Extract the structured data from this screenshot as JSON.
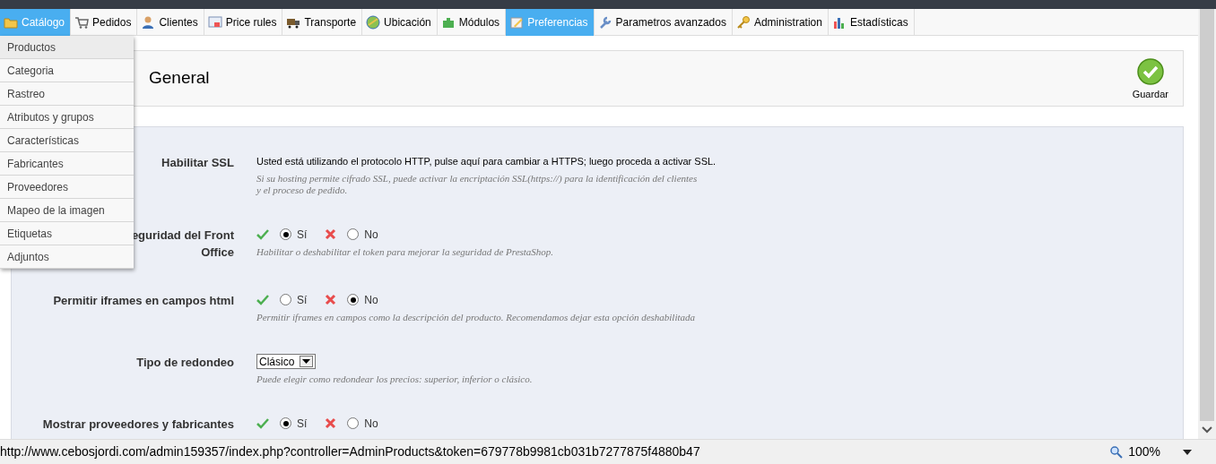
{
  "nav": [
    {
      "label": "Catálogo",
      "selected": true
    },
    {
      "label": "Pedidos",
      "selected": false
    },
    {
      "label": "Clientes",
      "selected": false
    },
    {
      "label": "Price rules",
      "selected": false
    },
    {
      "label": "Transporte",
      "selected": false
    },
    {
      "label": "Ubicación",
      "selected": false
    },
    {
      "label": "Módulos",
      "selected": false
    },
    {
      "label": "Preferencias",
      "selected": true
    },
    {
      "label": "Parametros avanzados",
      "selected": false
    },
    {
      "label": "Administration",
      "selected": false
    },
    {
      "label": "Estadísticas",
      "selected": false
    }
  ],
  "dropdown": [
    {
      "label": "Productos",
      "selected": true
    },
    {
      "label": "Categoria",
      "selected": false
    },
    {
      "label": "Rastreo",
      "selected": false
    },
    {
      "label": "Atributos y grupos",
      "selected": false
    },
    {
      "label": "Características",
      "selected": false
    },
    {
      "label": "Fabricantes",
      "selected": false
    },
    {
      "label": "Proveedores",
      "selected": false
    },
    {
      "label": "Mapeo de la imagen",
      "selected": false
    },
    {
      "label": "Etiquetas",
      "selected": false
    },
    {
      "label": "Adjuntos",
      "selected": false
    }
  ],
  "header": {
    "title": "General",
    "save_button": "Guardar"
  },
  "fields": [
    {
      "kind": "notice",
      "label": "Habilitar SSL",
      "text": "Usted está utilizando el protocolo HTTP, pulse aquí para cambiar a HTTPS; luego proceda a activar SSL.",
      "hint": "Si su hosting permite cifrado SSL, puede activar la encriptación SSL(https://) para la identificación del clientes y el proceso de pedido."
    },
    {
      "kind": "radio",
      "label": "eguridad del Front Office",
      "options": [
        {
          "label": "Sí",
          "selected": true
        },
        {
          "label": "No",
          "selected": false
        }
      ],
      "hint": "Habilitar o deshabilitar el token para mejorar la seguridad de PrestaShop."
    },
    {
      "kind": "radio",
      "label": "Permitir iframes en campos html",
      "options": [
        {
          "label": "Sí",
          "selected": false
        },
        {
          "label": "No",
          "selected": true
        }
      ],
      "hint": "Permitir iframes en campos como la descripción del producto. Recomendamos dejar esta opción deshabilitada"
    },
    {
      "kind": "select",
      "label": "Tipo de redondeo",
      "value": "Clásico",
      "hint": "Puede elegir como redondear los precios: superior, inferior o clásico."
    },
    {
      "kind": "radio",
      "label": "Mostrar proveedores y fabricantes",
      "options": [
        {
          "label": "Sí",
          "selected": true
        },
        {
          "label": "No",
          "selected": false
        }
      ]
    }
  ],
  "status_bar": {
    "url": "http://www.cebosjordi.com/admin159357/index.php?controller=AdminProducts&token=679778b9981cb031b7277875f4880b47",
    "zoom": "100%"
  }
}
